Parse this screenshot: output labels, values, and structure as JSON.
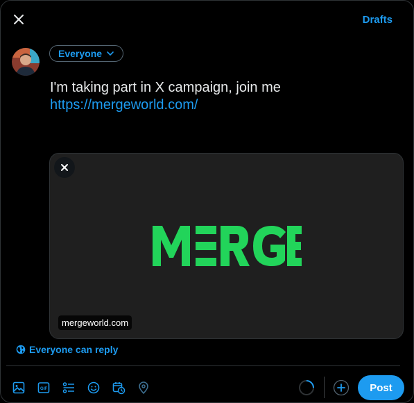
{
  "header": {
    "close_icon": "close-icon",
    "drafts_label": "Drafts"
  },
  "composer": {
    "audience_label": "Everyone",
    "text": "I'm taking part in X campaign, join me",
    "link": "https://mergeworld.com/"
  },
  "link_card": {
    "logo_text": "MERGE",
    "domain": "mergeworld.com",
    "logo_color": "#22d45a"
  },
  "reply_setting": {
    "label": "Everyone can reply",
    "icon": "globe-icon"
  },
  "toolbar": {
    "icons": [
      "image-icon",
      "gif-icon",
      "poll-icon",
      "emoji-icon",
      "schedule-icon",
      "location-icon"
    ],
    "post_label": "Post"
  },
  "colors": {
    "accent": "#1d9bf0",
    "background": "#000000",
    "text": "#e7e9ea",
    "border": "#2f3336"
  }
}
